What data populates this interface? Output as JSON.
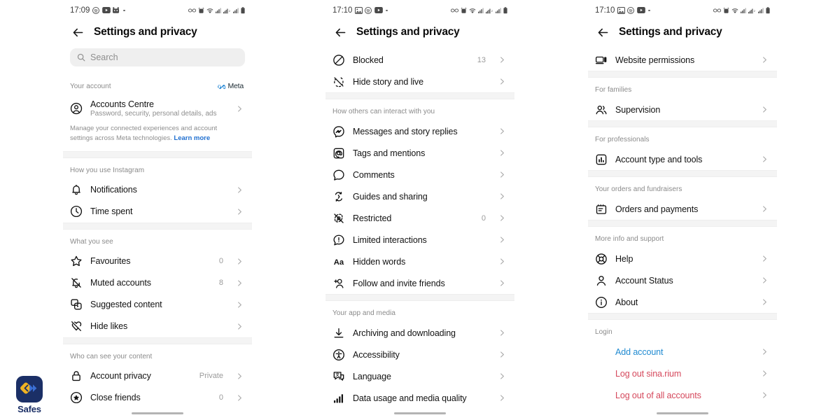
{
  "app": {
    "title": "Settings and privacy",
    "back_icon": "back-arrow-icon"
  },
  "watermark": {
    "label": "Safes",
    "badge_color": "#1b2f66",
    "accent_color": "#f0b323"
  },
  "panels": [
    {
      "status_bar": {
        "time": "17:09",
        "left_icons": [
          "spotify-icon",
          "youtube-icon",
          "app-icon",
          "status-dot"
        ],
        "right_icons": [
          "glasses-icon",
          "alarm-icon",
          "wifi-icon",
          "signal-icon",
          "sim-signal-icon",
          "signal2-icon",
          "battery-icon"
        ]
      },
      "search": {
        "placeholder": "Search",
        "value": ""
      },
      "sections": [
        {
          "head": "Your account",
          "badge": "Meta",
          "rows": [
            {
              "icon": "account-circle-icon",
              "label": "Accounts Centre",
              "sub": "Password, security, personal details, ads",
              "value": "",
              "chevron": true,
              "tall": true
            }
          ],
          "note": {
            "text": "Manage your connected experiences and account settings across Meta technologies. ",
            "link": "Learn more"
          }
        },
        {
          "head": "How you use Instagram",
          "rows": [
            {
              "icon": "bell-icon",
              "label": "Notifications",
              "value": "",
              "chevron": true
            },
            {
              "icon": "clock-icon",
              "label": "Time spent",
              "value": "",
              "chevron": true
            }
          ]
        },
        {
          "head": "What you see",
          "rows": [
            {
              "icon": "star-icon",
              "label": "Favourites",
              "value": "0",
              "chevron": true
            },
            {
              "icon": "bell-off-icon",
              "label": "Muted accounts",
              "value": "8",
              "chevron": true
            },
            {
              "icon": "suggested-content-icon",
              "label": "Suggested content",
              "value": "",
              "chevron": true
            },
            {
              "icon": "heart-off-icon",
              "label": "Hide likes",
              "value": "",
              "chevron": true
            }
          ]
        },
        {
          "head": "Who can see your content",
          "rows": [
            {
              "icon": "lock-icon",
              "label": "Account privacy",
              "value": "Private",
              "chevron": true
            },
            {
              "icon": "close-friends-icon",
              "label": "Close friends",
              "value": "0",
              "chevron": true
            }
          ]
        }
      ]
    },
    {
      "status_bar": {
        "time": "17:10",
        "left_icons": [
          "photos-icon",
          "spotify-icon",
          "youtube-icon",
          "status-dot"
        ],
        "right_icons": [
          "glasses-icon",
          "alarm-icon",
          "wifi-icon",
          "signal-icon",
          "sim-signal-icon",
          "signal2-icon",
          "battery-icon"
        ]
      },
      "sections": [
        {
          "head": "",
          "rows": [
            {
              "icon": "blocked-icon",
              "label": "Blocked",
              "value": "13",
              "chevron": true
            },
            {
              "icon": "hide-story-icon",
              "label": "Hide story and live",
              "value": "",
              "chevron": true
            }
          ]
        },
        {
          "head": "How others can interact with you",
          "rows": [
            {
              "icon": "messenger-icon",
              "label": "Messages and story replies",
              "value": "",
              "chevron": true
            },
            {
              "icon": "at-icon",
              "label": "Tags and mentions",
              "value": "",
              "chevron": true
            },
            {
              "icon": "comment-icon",
              "label": "Comments",
              "value": "",
              "chevron": true
            },
            {
              "icon": "share-icon",
              "label": "Guides and sharing",
              "value": "",
              "chevron": true
            },
            {
              "icon": "restricted-icon",
              "label": "Restricted",
              "value": "0",
              "chevron": true
            },
            {
              "icon": "limited-icon",
              "label": "Limited interactions",
              "value": "",
              "chevron": true
            },
            {
              "icon": "hidden-words-icon",
              "label": "Hidden words",
              "value": "",
              "chevron": true
            },
            {
              "icon": "add-friend-icon",
              "label": "Follow and invite friends",
              "value": "",
              "chevron": true
            }
          ]
        },
        {
          "head": "Your app and media",
          "rows": [
            {
              "icon": "download-icon",
              "label": "Archiving and downloading",
              "value": "",
              "chevron": true
            },
            {
              "icon": "accessibility-icon",
              "label": "Accessibility",
              "value": "",
              "chevron": true
            },
            {
              "icon": "language-icon",
              "label": "Language",
              "value": "",
              "chevron": true
            },
            {
              "icon": "data-usage-icon",
              "label": "Data usage and media quality",
              "value": "",
              "chevron": true
            }
          ]
        }
      ]
    },
    {
      "status_bar": {
        "time": "17:10",
        "left_icons": [
          "photos-icon",
          "spotify-icon",
          "youtube-icon",
          "status-dot"
        ],
        "right_icons": [
          "glasses-icon",
          "alarm-icon",
          "wifi-icon",
          "signal-icon",
          "sim-signal-icon",
          "signal2-icon",
          "battery-icon"
        ]
      },
      "sections": [
        {
          "head": "",
          "rows": [
            {
              "icon": "website-permissions-icon",
              "label": "Website permissions",
              "value": "",
              "chevron": true
            }
          ]
        },
        {
          "head": "For families",
          "rows": [
            {
              "icon": "supervision-icon",
              "label": "Supervision",
              "value": "",
              "chevron": true
            }
          ]
        },
        {
          "head": "For professionals",
          "rows": [
            {
              "icon": "account-type-icon",
              "label": "Account type and tools",
              "value": "",
              "chevron": true
            }
          ]
        },
        {
          "head": "Your orders and fundraisers",
          "rows": [
            {
              "icon": "orders-icon",
              "label": "Orders and payments",
              "value": "",
              "chevron": true
            }
          ]
        },
        {
          "head": "More info and support",
          "rows": [
            {
              "icon": "help-icon",
              "label": "Help",
              "value": "",
              "chevron": true
            },
            {
              "icon": "person-icon",
              "label": "Account Status",
              "value": "",
              "chevron": true
            },
            {
              "icon": "info-icon",
              "label": "About",
              "value": "",
              "chevron": true
            }
          ]
        },
        {
          "head": "Login",
          "rows": [
            {
              "icon": "",
              "label": "Add account",
              "value": "",
              "chevron": true,
              "style": "link-blue"
            },
            {
              "icon": "",
              "label": "Log out sina.rium",
              "value": "",
              "chevron": true,
              "style": "link-red"
            },
            {
              "icon": "",
              "label": "Log out of all accounts",
              "value": "",
              "chevron": true,
              "style": "link-red"
            }
          ]
        }
      ]
    }
  ]
}
